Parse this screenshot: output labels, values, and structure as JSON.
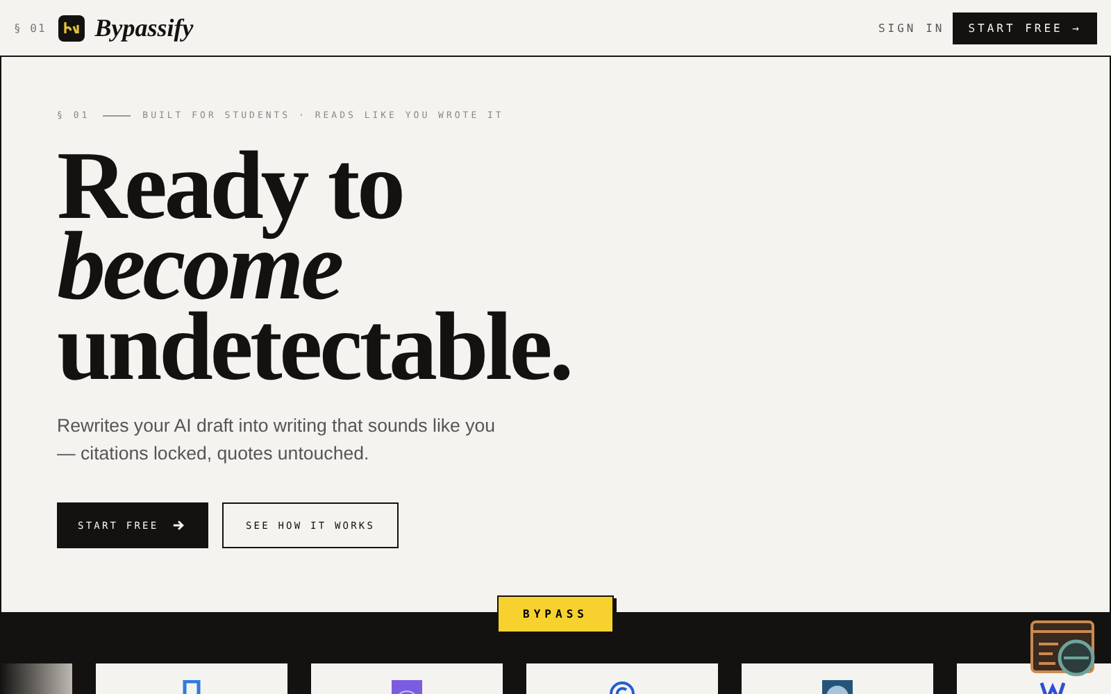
{
  "header": {
    "section_mark": "§ 01",
    "brand": "Bypassify",
    "sign_in": "SIGN IN",
    "cta": "START FREE →"
  },
  "hero": {
    "eyebrow_mark": "§ 01",
    "eyebrow": "BUILT FOR STUDENTS · READS LIKE YOU WROTE IT",
    "headline": [
      {
        "text": "Ready to",
        "italic": false
      },
      {
        "text": "become",
        "italic": true
      },
      {
        "text": "undetectable.",
        "italic": false
      }
    ],
    "subtitle": "Rewrites your AI draft into writing that sounds like you — citations locked, quotes untouched.",
    "buttons": [
      {
        "label": "START FREE",
        "kind": "primary"
      },
      {
        "label": "SEE HOW IT WORKS",
        "kind": "secondary"
      }
    ]
  },
  "badge": "BYPASS",
  "logos": [
    {
      "kind": "faded"
    },
    {
      "kind": "square"
    },
    {
      "kind": "rings"
    },
    {
      "kind": "circle"
    },
    {
      "kind": "globe"
    },
    {
      "kind": "letter"
    }
  ]
}
